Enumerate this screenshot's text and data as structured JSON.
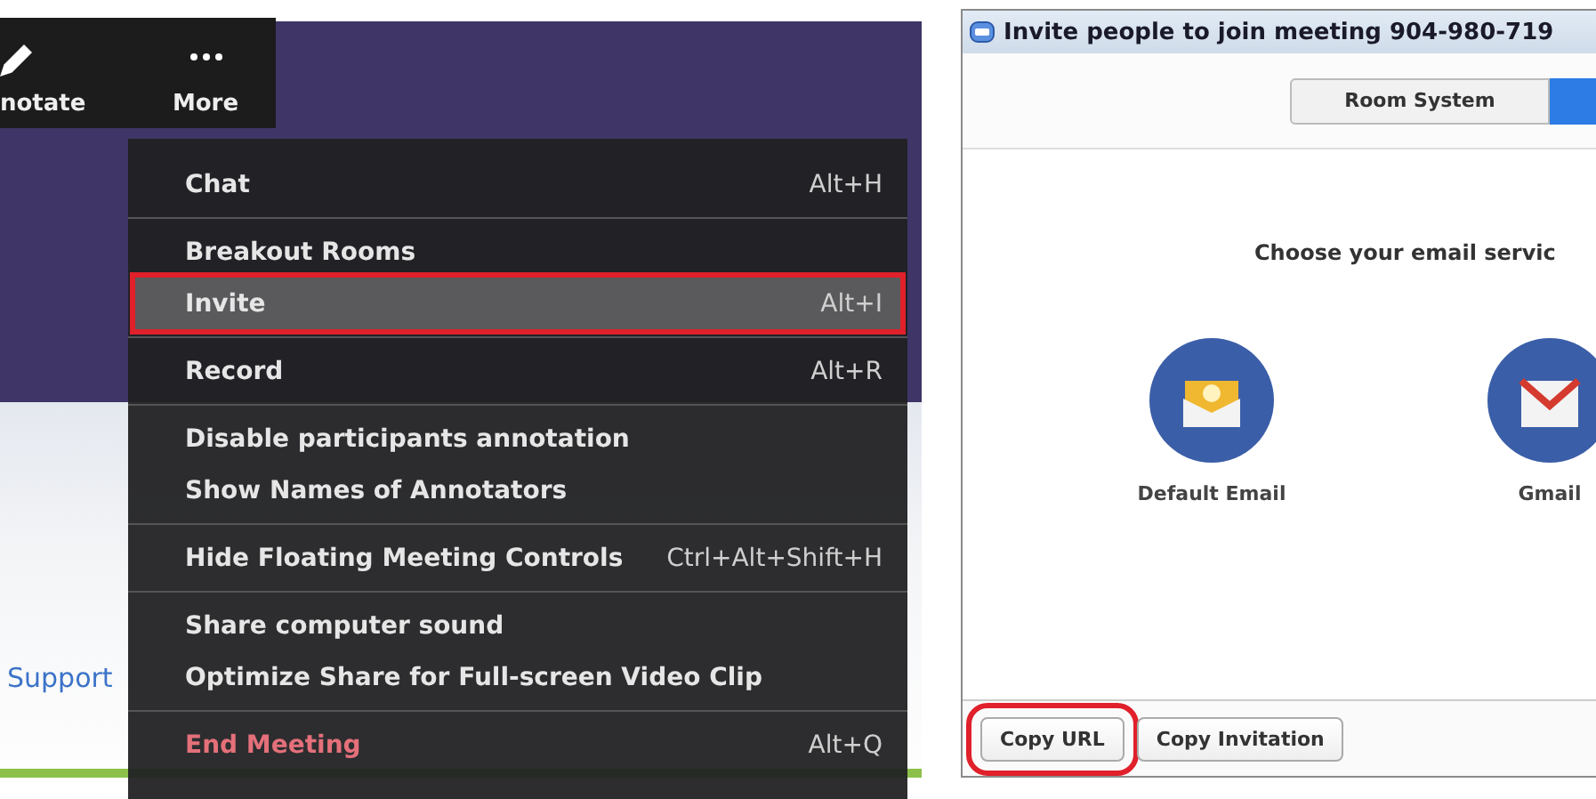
{
  "meeting_toolbar": [
    {
      "label": "notate",
      "kind": "annotate"
    },
    {
      "label": "More",
      "kind": "more"
    }
  ],
  "web_page": {
    "link": "Support"
  },
  "menu": {
    "groups": [
      {
        "items": [
          {
            "label": "Chat",
            "shortcut": "Alt+H",
            "kind": "normal",
            "selected": false,
            "annotated": false
          }
        ]
      },
      {
        "items": [
          {
            "label": "Breakout Rooms",
            "kind": "normal",
            "selected": false,
            "annotated": false
          },
          {
            "label": "Invite",
            "shortcut": "Alt+I",
            "kind": "normal",
            "selected": true,
            "annotated": true
          }
        ]
      },
      {
        "items": [
          {
            "label": "Record",
            "shortcut": "Alt+R",
            "kind": "normal",
            "selected": false,
            "annotated": false
          }
        ]
      },
      {
        "items": [
          {
            "label": "Disable participants annotation",
            "kind": "normal",
            "selected": false,
            "annotated": false
          },
          {
            "label": "Show Names of Annotators",
            "kind": "normal",
            "selected": false,
            "annotated": false
          }
        ]
      },
      {
        "items": [
          {
            "label": "Hide Floating Meeting Controls",
            "shortcut": "Ctrl+Alt+Shift+H",
            "kind": "normal",
            "selected": false,
            "annotated": false
          }
        ]
      },
      {
        "items": [
          {
            "label": "Share computer sound",
            "kind": "normal",
            "selected": false,
            "annotated": false
          },
          {
            "label": "Optimize Share for Full-screen Video Clip",
            "kind": "normal",
            "selected": false,
            "annotated": false
          }
        ]
      },
      {
        "items": [
          {
            "label": "End Meeting",
            "shortcut": "Alt+Q",
            "kind": "danger",
            "selected": false,
            "annotated": false
          }
        ]
      }
    ]
  },
  "invite_window": {
    "title": "Invite people to join meeting 904-980-719",
    "tabs": [
      {
        "label": "Room System",
        "selected": false
      },
      {
        "selected": true
      }
    ],
    "heading": "Choose your email servic",
    "services": [
      {
        "label": "Default Email",
        "kind": "default"
      },
      {
        "label": "Gmail",
        "kind": "gmail"
      }
    ],
    "buttons": [
      {
        "label": "Copy URL",
        "annotated": true
      },
      {
        "label": "Copy Invitation",
        "annotated": false
      }
    ]
  }
}
